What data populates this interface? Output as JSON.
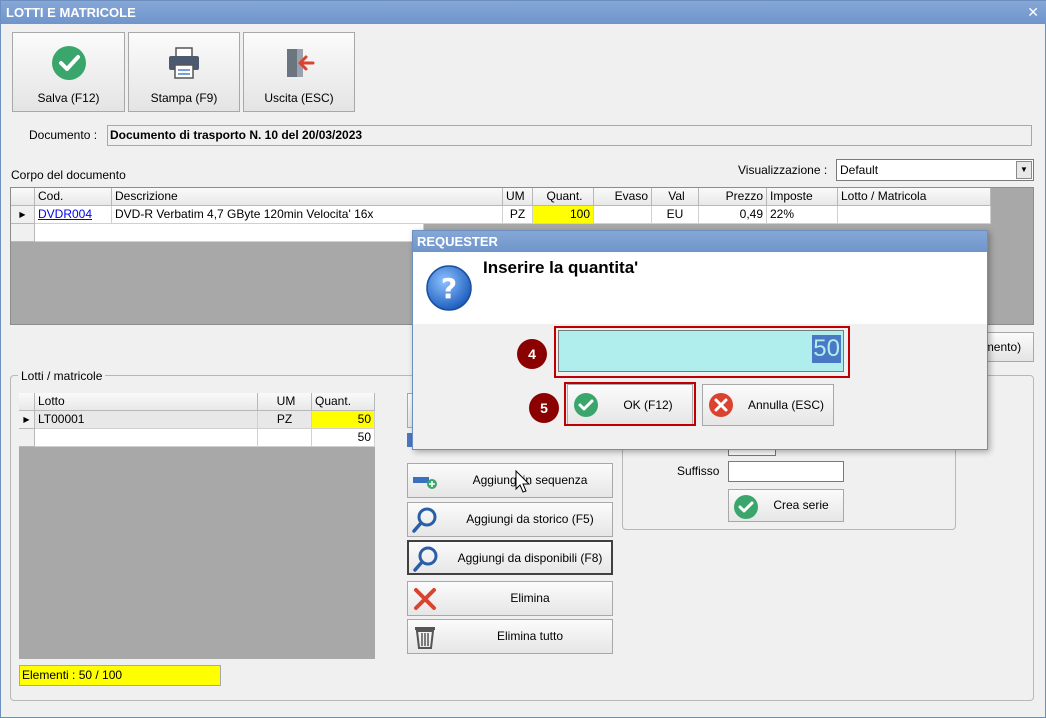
{
  "window": {
    "title": "LOTTI E MATRICOLE",
    "close_glyph": "✕"
  },
  "toolbar": {
    "save_label": "Salva (F12)",
    "print_label": "Stampa (F9)",
    "exit_label": "Uscita (ESC)"
  },
  "document": {
    "label": "Documento :",
    "value": "Documento di trasporto N. 10 del 20/03/2023"
  },
  "body_section": {
    "label": "Corpo del documento"
  },
  "view": {
    "label": "Visualizzazione :",
    "selected": "Default"
  },
  "grid": {
    "headers": [
      "Cod.",
      "Descrizione",
      "UM",
      "Quant.",
      "Evaso",
      "Val",
      "Prezzo",
      "Imposte",
      "Lotto / Matricola"
    ],
    "row": {
      "cod": "DVDR004",
      "descrizione": "DVD-R Verbatim 4,7 GByte 120min  Velocita' 16x",
      "um": "PZ",
      "quant": "100",
      "evaso": "",
      "val": "EU",
      "prezzo": "0,49",
      "imposte": "22%",
      "lotto": ""
    }
  },
  "partial_button": {
    "label": "mento)"
  },
  "lots": {
    "group_title": "Lotti / matricole",
    "headers": [
      "Lotto",
      "UM",
      "Quant."
    ],
    "rows": [
      {
        "lotto": "LT00001",
        "um": "PZ",
        "quant": "50"
      },
      {
        "lotto": "",
        "um": "",
        "quant": "50"
      }
    ],
    "elements": "Elementi : 50 / 100"
  },
  "actions": {
    "add_sequence": "Aggiungi in sequenza",
    "add_history": "Aggiungi da storico (F5)",
    "add_available": "Aggiungi da disponibili (F8)",
    "delete": "Elimina",
    "delete_all": "Elimina tutto"
  },
  "series": {
    "suffix_label": "Suffisso",
    "create_label": "Crea serie"
  },
  "dialog": {
    "title": "REQUESTER",
    "message": "Inserire la quantita'",
    "value": "50",
    "ok_label": "OK (F12)",
    "cancel_label": "Annulla (ESC)"
  },
  "annotations": {
    "step4": "4",
    "step5": "5"
  },
  "colors": {
    "accent_green": "#3aa66b",
    "title_blue": "#7a9fd2",
    "highlight_yellow": "#ffff00",
    "input_cyan": "#b0eeee",
    "badge_red": "#8b0000"
  },
  "icons": [
    "check-icon",
    "printer-icon",
    "exit-door-icon",
    "question-icon",
    "search-icon",
    "delete-x-icon",
    "trash-icon",
    "add-sequence-icon",
    "cancel-icon",
    "cursor-icon"
  ]
}
